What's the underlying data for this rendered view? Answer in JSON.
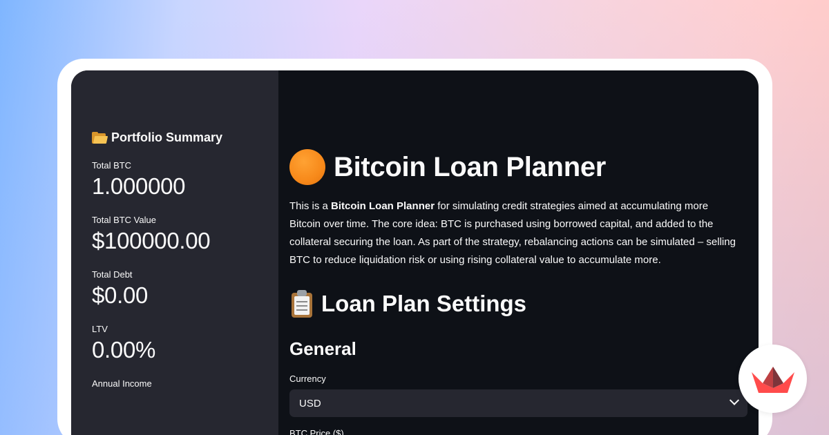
{
  "sidebar": {
    "title": "Portfolio Summary",
    "title_icon": "folder-icon",
    "metrics": [
      {
        "label": "Total BTC",
        "value": "1.000000"
      },
      {
        "label": "Total BTC Value",
        "value": "$100000.00"
      },
      {
        "label": "Total Debt",
        "value": "$0.00"
      },
      {
        "label": "LTV",
        "value": "0.00%"
      },
      {
        "label": "Annual Income",
        "value": ""
      }
    ]
  },
  "main": {
    "title": "Bitcoin Loan Planner",
    "title_icon": "orange-circle-icon",
    "intro": {
      "prefix": "This is a ",
      "bold": "Bitcoin Loan Planner",
      "suffix": " for simulating credit strategies aimed at accumulating more Bitcoin over time. The core idea: BTC is purchased using borrowed capital, and added to the collateral securing the loan. As part of the strategy, rebalancing actions can be simulated – selling BTC to reduce liquidation risk or using rising collateral value to accumulate more."
    },
    "section_title": "Loan Plan Settings",
    "section_icon": "clipboard-icon",
    "subsection_title": "General",
    "currency": {
      "label": "Currency",
      "value": "USD"
    },
    "next_field_label": "BTC Price ($)"
  },
  "colors": {
    "app_bg": "#0e1117",
    "sidebar_bg": "#262730",
    "input_bg": "#262730",
    "text": "#fafafa",
    "accent_orange": "#f7931a",
    "logo_red": "#ff4b4b"
  },
  "logo": {
    "name": "streamlit-logo-icon"
  }
}
